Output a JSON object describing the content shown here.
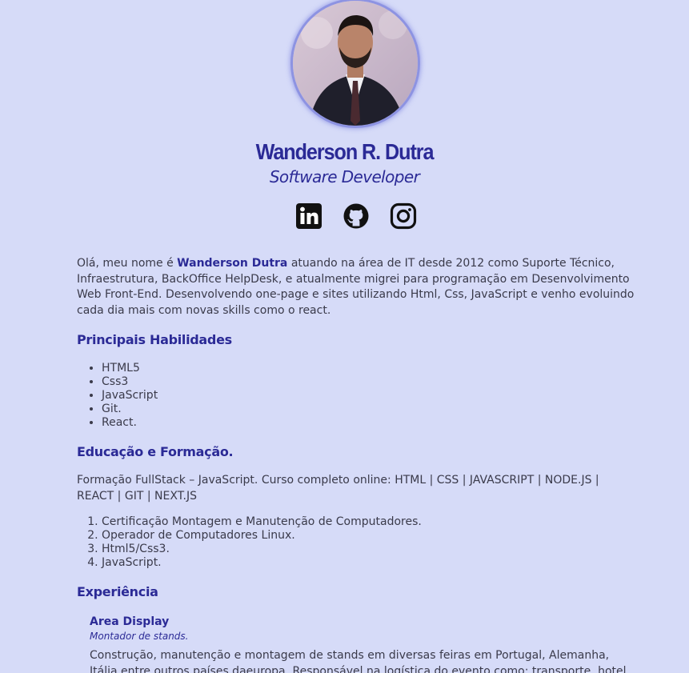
{
  "profile": {
    "name": "Wanderson R. Dutra",
    "title": "Software Developer"
  },
  "socials": [
    {
      "name": "linkedin-icon"
    },
    {
      "name": "github-icon"
    },
    {
      "name": "instagram-icon"
    }
  ],
  "about": {
    "intro": "Olá, meu nome é ",
    "highlight": "Wanderson Dutra",
    "rest": " atuando na área de IT desde 2012 como Suporte Técnico, Infraestrutura, BackOffice HelpDesk, e atualmente migrei para programação em Desenvolvimento Web Front-End. Desenvolvendo one-page e sites utilizando Html, Css, JavaScript e venho evoluindo cada dia mais com novas skills como o react."
  },
  "skills": {
    "title": "Principais Habilidades",
    "items": [
      "HTML5",
      "Css3",
      "JavaScript",
      "Git.",
      "React."
    ]
  },
  "education": {
    "title": "Educação e Formação.",
    "summary": "Formação FullStack – JavaScript. Curso completo online: HTML | CSS | JAVASCRIPT | NODE.JS | REACT | GIT | NEXT.JS",
    "items": [
      "Certificação Montagem e Manutenção de Computadores.",
      "Operador de Computadores Linux.",
      "Html5/Css3.",
      "JavaScript."
    ]
  },
  "experience": {
    "title": "Experiência",
    "jobs": [
      {
        "company": "Area Display",
        "role": "Montador de stands.",
        "description": "Construção, manutenção e montagem de stands em diversas feiras em Portugal, Alemanha, Itália entre outros países daeuropa. Responsável na logística do evento como: transporte, hotel"
      }
    ]
  },
  "colors": {
    "background": "#d6dbf8",
    "accent": "#2b2a96",
    "text": "#3a3a4a"
  }
}
